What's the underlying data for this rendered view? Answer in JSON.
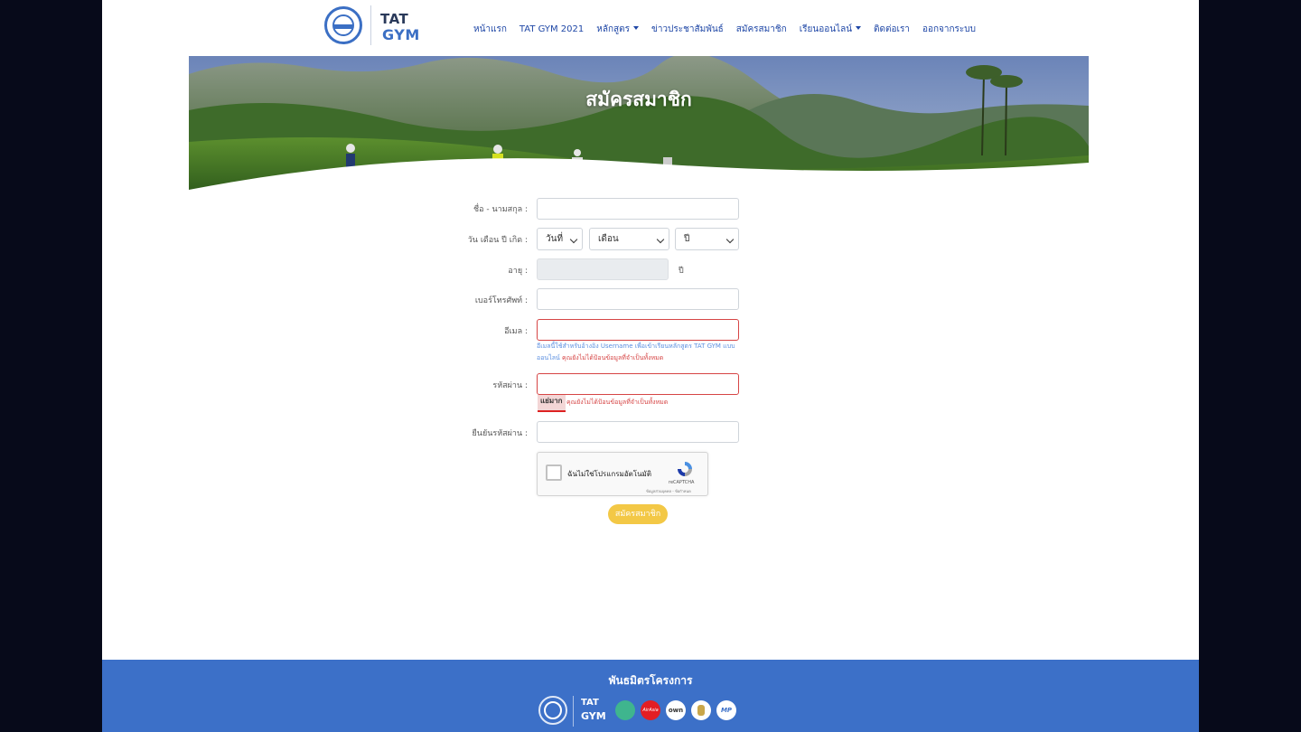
{
  "header": {
    "logo_tat": "ททท",
    "logo_gym_line1": "TAT",
    "logo_gym_line2": "GYM",
    "nav": [
      {
        "label": "หน้าแรก",
        "has_dropdown": false
      },
      {
        "label": "TAT GYM 2021",
        "has_dropdown": false
      },
      {
        "label": "หลักสูตร",
        "has_dropdown": true
      },
      {
        "label": "ข่าวประชาสัมพันธ์",
        "has_dropdown": false
      },
      {
        "label": "สมัครสมาชิก",
        "has_dropdown": false
      },
      {
        "label": "เรียนออนไลน์",
        "has_dropdown": true
      },
      {
        "label": "ติดต่อเรา",
        "has_dropdown": false
      },
      {
        "label": "ออกจากระบบ",
        "has_dropdown": false
      }
    ]
  },
  "banner": {
    "title": "สมัครสมาชิก"
  },
  "form": {
    "name_label": "ชื่อ - นามสกุล :",
    "name_value": "",
    "dob_label": "วัน เดือน ปี เกิด :",
    "day_select": "วันที่",
    "month_select": "เดือน",
    "year_select": "ปี",
    "age_label": "อายุ :",
    "age_unit": "ปี",
    "phone_label": "เบอร์โทรศัพท์ :",
    "email_label": "อีเมล :",
    "email_hint": "อีเมลนี้ใช้สำหรับอ้างอิง Username เพื่อเข้าเรียนหลักสูตร TAT GYM แบบออนไลน์",
    "email_error": "คุณยังไม่ได้ป้อนข้อมูลที่จำเป็นทั้งหมด",
    "password_label": "รหัสผ่าน :",
    "password_strength": "แย่มาก",
    "password_error": "คุณยังไม่ได้ป้อนข้อมูลที่จำเป็นทั้งหมด",
    "confirm_label": "ยืนยันรหัสผ่าน :",
    "captcha_text": "ฉันไม่ใช่โปรแกรมอัตโนมัติ",
    "captcha_brand": "reCAPTCHA",
    "captcha_terms": "ข้อมูลส่วนบุคคล - ข้อกำหนด",
    "submit_label": "สมัครสมาชิก"
  },
  "footer": {
    "title": "พันธมิตรโครงการ",
    "partners": [
      "tat-logo",
      "tat-gym-logo",
      "partner-green-logo",
      "airasia-logo",
      "own-logo",
      "partner-emblem-logo",
      "mp-logo"
    ],
    "partner_texts": {
      "gym1": "TAT",
      "gym2": "GYM",
      "airasia": "AirAsia",
      "own": "own",
      "mp": "MP"
    }
  },
  "colors": {
    "nav_text": "#1f47a6",
    "footer_bg": "#3c70c8",
    "submit_bg": "#f3c846",
    "error": "#d64545",
    "hint": "#5b8fe0"
  }
}
